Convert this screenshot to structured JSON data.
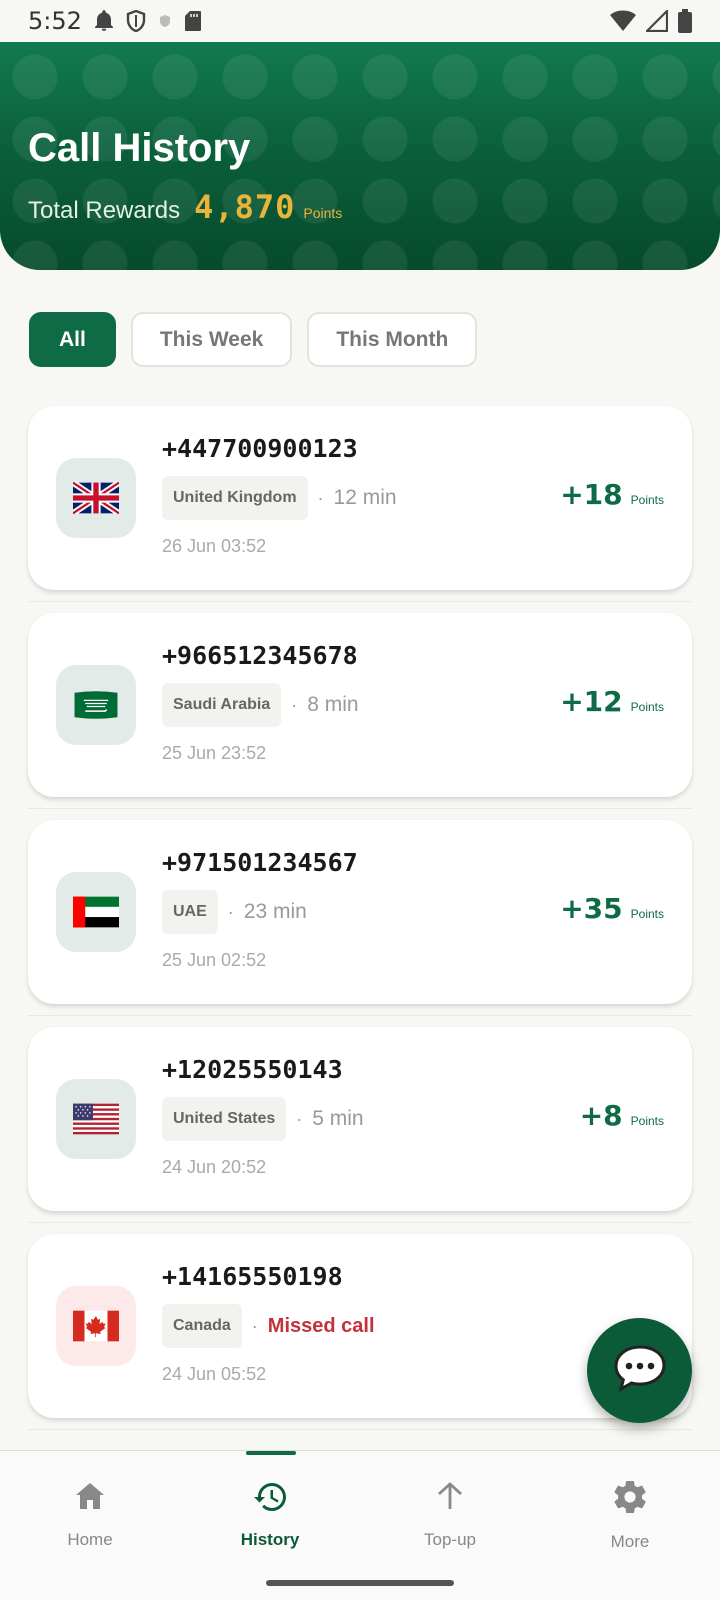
{
  "status_bar": {
    "time": "5:52"
  },
  "header": {
    "title": "Call History",
    "rewards_label": "Total Rewards",
    "rewards_value": "4,870",
    "rewards_unit": "Points"
  },
  "filters": [
    {
      "label": "All",
      "active": true
    },
    {
      "label": "This Week",
      "active": false
    },
    {
      "label": "This Month",
      "active": false
    }
  ],
  "calls": [
    {
      "phone": "+447700900123",
      "country": "United Kingdom",
      "duration": "12 min",
      "date": "26 Jun 03:52",
      "points": "+18",
      "points_unit": "Points",
      "flag": "uk-flag-icon"
    },
    {
      "phone": "+966512345678",
      "country": "Saudi Arabia",
      "duration": "8 min",
      "date": "25 Jun 23:52",
      "points": "+12",
      "points_unit": "Points",
      "flag": "saudi-flag-icon"
    },
    {
      "phone": "+971501234567",
      "country": "UAE",
      "duration": "23 min",
      "date": "25 Jun 02:52",
      "points": "+35",
      "points_unit": "Points",
      "flag": "uae-flag-icon"
    },
    {
      "phone": "+12025550143",
      "country": "United States",
      "duration": "5 min",
      "date": "24 Jun 20:52",
      "points": "+8",
      "points_unit": "Points",
      "flag": "us-flag-icon"
    },
    {
      "phone": "+14165550198",
      "country": "Canada",
      "status": "Missed call",
      "date": "24 Jun 05:52",
      "flag": "canada-flag-icon"
    }
  ],
  "separator": "·",
  "nav": [
    {
      "label": "Home",
      "icon": "home-icon",
      "active": false
    },
    {
      "label": "History",
      "icon": "history-icon",
      "active": true
    },
    {
      "label": "Top-up",
      "icon": "arrow-up-icon",
      "active": false
    },
    {
      "label": "More",
      "icon": "gear-icon",
      "active": false
    }
  ],
  "colors": {
    "primary": "#0f6b45",
    "header_dark": "#064a2c",
    "rewards_gold": "#e8b43a",
    "missed_red": "#c5303b"
  }
}
